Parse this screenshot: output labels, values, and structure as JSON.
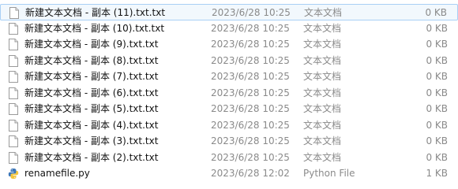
{
  "files": [
    {
      "name": "新建文本文档 - 副本 (11).txt.txt",
      "date": "2023/6/28 10:25",
      "type": "文本文档",
      "size": "0 KB",
      "icon": "text-file-icon",
      "selected": true
    },
    {
      "name": "新建文本文档 - 副本 (10).txt.txt",
      "date": "2023/6/28 10:25",
      "type": "文本文档",
      "size": "0 KB",
      "icon": "text-file-icon"
    },
    {
      "name": "新建文本文档 - 副本 (9).txt.txt",
      "date": "2023/6/28 10:25",
      "type": "文本文档",
      "size": "0 KB",
      "icon": "text-file-icon"
    },
    {
      "name": "新建文本文档 - 副本 (8).txt.txt",
      "date": "2023/6/28 10:25",
      "type": "文本文档",
      "size": "0 KB",
      "icon": "text-file-icon"
    },
    {
      "name": "新建文本文档 - 副本 (7).txt.txt",
      "date": "2023/6/28 10:25",
      "type": "文本文档",
      "size": "0 KB",
      "icon": "text-file-icon"
    },
    {
      "name": "新建文本文档 - 副本 (6).txt.txt",
      "date": "2023/6/28 10:25",
      "type": "文本文档",
      "size": "0 KB",
      "icon": "text-file-icon"
    },
    {
      "name": "新建文本文档 - 副本 (5).txt.txt",
      "date": "2023/6/28 10:25",
      "type": "文本文档",
      "size": "0 KB",
      "icon": "text-file-icon"
    },
    {
      "name": "新建文本文档 - 副本 (4).txt.txt",
      "date": "2023/6/28 10:25",
      "type": "文本文档",
      "size": "0 KB",
      "icon": "text-file-icon"
    },
    {
      "name": "新建文本文档 - 副本 (3).txt.txt",
      "date": "2023/6/28 10:25",
      "type": "文本文档",
      "size": "0 KB",
      "icon": "text-file-icon"
    },
    {
      "name": "新建文本文档 - 副本 (2).txt.txt",
      "date": "2023/6/28 10:25",
      "type": "文本文档",
      "size": "0 KB",
      "icon": "text-file-icon"
    },
    {
      "name": "renamefile.py",
      "date": "2023/6/28 12:02",
      "type": "Python File",
      "size": "1 KB",
      "icon": "python-file-icon"
    }
  ]
}
